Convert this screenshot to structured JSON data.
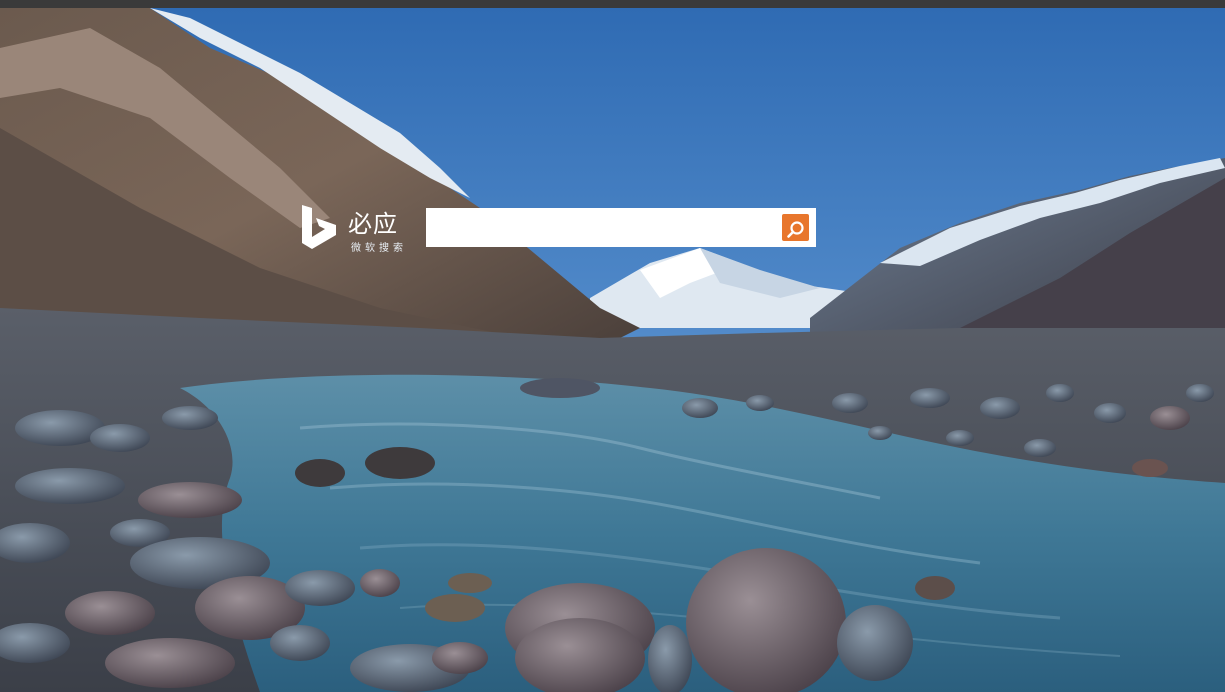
{
  "brand": {
    "name": "必应",
    "subtitle": "微软搜索",
    "logo_icon": "bing-logo-icon"
  },
  "search": {
    "value": "",
    "placeholder": "",
    "button_icon": "search-icon"
  },
  "background": {
    "description_icon": "himalaya-river-photo"
  },
  "colors": {
    "accent": "#e8762c",
    "search_bg": "#ffffff",
    "top_bar": "#3a3a3a"
  }
}
